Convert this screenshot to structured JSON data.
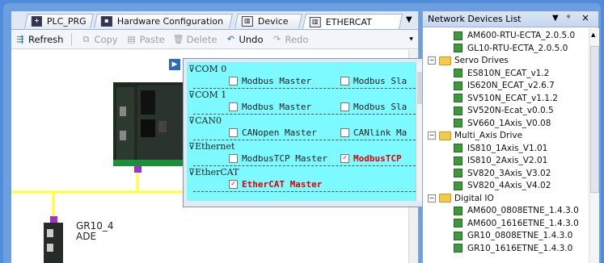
{
  "tabs": [
    {
      "label": "PLC_PRG",
      "icon": "program-icon"
    },
    {
      "label": "Hardware Configuration",
      "icon": "hardware-icon"
    },
    {
      "label": "Device",
      "icon": "device-icon"
    },
    {
      "label": "ETHERCAT",
      "icon": "ethercat-icon",
      "active": true
    }
  ],
  "toolbar": {
    "refresh": "Refresh",
    "copy": "Copy",
    "paste": "Paste",
    "delete": "Delete",
    "undo": "Undo",
    "redo": "Redo"
  },
  "canvas": {
    "device_label_line1": "GR10_4",
    "device_label_line2": "ADE"
  },
  "popup": {
    "sections": [
      {
        "title": "COM 0",
        "options": [
          {
            "label": "Modbus Master",
            "checked": false
          },
          {
            "label": "Modbus Sla",
            "checked": false
          }
        ]
      },
      {
        "title": "COM 1",
        "options": [
          {
            "label": "Modbus Master",
            "checked": false
          },
          {
            "label": "Modbus Sla",
            "checked": false
          }
        ]
      },
      {
        "title": "CAN0",
        "options": [
          {
            "label": "CANopen Master",
            "checked": false
          },
          {
            "label": "CANlink Ma",
            "checked": false
          }
        ]
      },
      {
        "title": "Ethernet",
        "options": [
          {
            "label": "ModbusTCP Master",
            "checked": false
          },
          {
            "label": "ModbusTCP",
            "checked": true
          }
        ]
      },
      {
        "title": "EtherCAT",
        "options": [
          {
            "label": "EtherCAT Master",
            "checked": true
          }
        ]
      }
    ]
  },
  "panel": {
    "title": "Network Devices List",
    "pin_glyph": "ᵠ",
    "close_glyph": "×",
    "tree": [
      {
        "type": "device",
        "label": "AM600-RTU-ECTA_2.0.5.0",
        "level": 2
      },
      {
        "type": "device",
        "label": "GL10-RTU-ECTA_2.0.5.0",
        "level": 2
      },
      {
        "type": "folder",
        "label": "Servo Drives",
        "level": 1
      },
      {
        "type": "device",
        "label": "ES810N_ECAT_v1.2",
        "level": 2
      },
      {
        "type": "device",
        "label": "IS620N_ECAT_v2.6.7",
        "level": 2
      },
      {
        "type": "device",
        "label": "SV510N_ECAT_v1.1.2",
        "level": 2
      },
      {
        "type": "device",
        "label": "SV520N-Ecat_v0.0.5",
        "level": 2
      },
      {
        "type": "device",
        "label": "SV660_1Axis_V0.08",
        "level": 2
      },
      {
        "type": "folder",
        "label": "Multi_Axis Drive",
        "level": 1
      },
      {
        "type": "device",
        "label": "IS810_1Axis_V1.01",
        "level": 2
      },
      {
        "type": "device",
        "label": "IS810_2Axis_V2.01",
        "level": 2
      },
      {
        "type": "device",
        "label": "SV820_3Axis_V3.02",
        "level": 2
      },
      {
        "type": "device",
        "label": "SV820_4Axis_V4.02",
        "level": 2
      },
      {
        "type": "folder",
        "label": "Digital IO",
        "level": 1
      },
      {
        "type": "device",
        "label": "AM600_0808ETNE_1.4.3.0",
        "level": 2
      },
      {
        "type": "device",
        "label": "AM600_1616ETNE_1.4.3.0",
        "level": 2
      },
      {
        "type": "device",
        "label": "GR10_0808ETNE_1.4.3.0",
        "level": 2
      },
      {
        "type": "device",
        "label": "GR10_1616ETNE_1.4.3.0",
        "level": 2
      }
    ]
  },
  "colors": {
    "frame": "#6d9fe0",
    "popup_bg": "#7dfaff",
    "bus_line": "#ffff33",
    "connector": "#9933cc",
    "checked_text": "#dd0000"
  }
}
